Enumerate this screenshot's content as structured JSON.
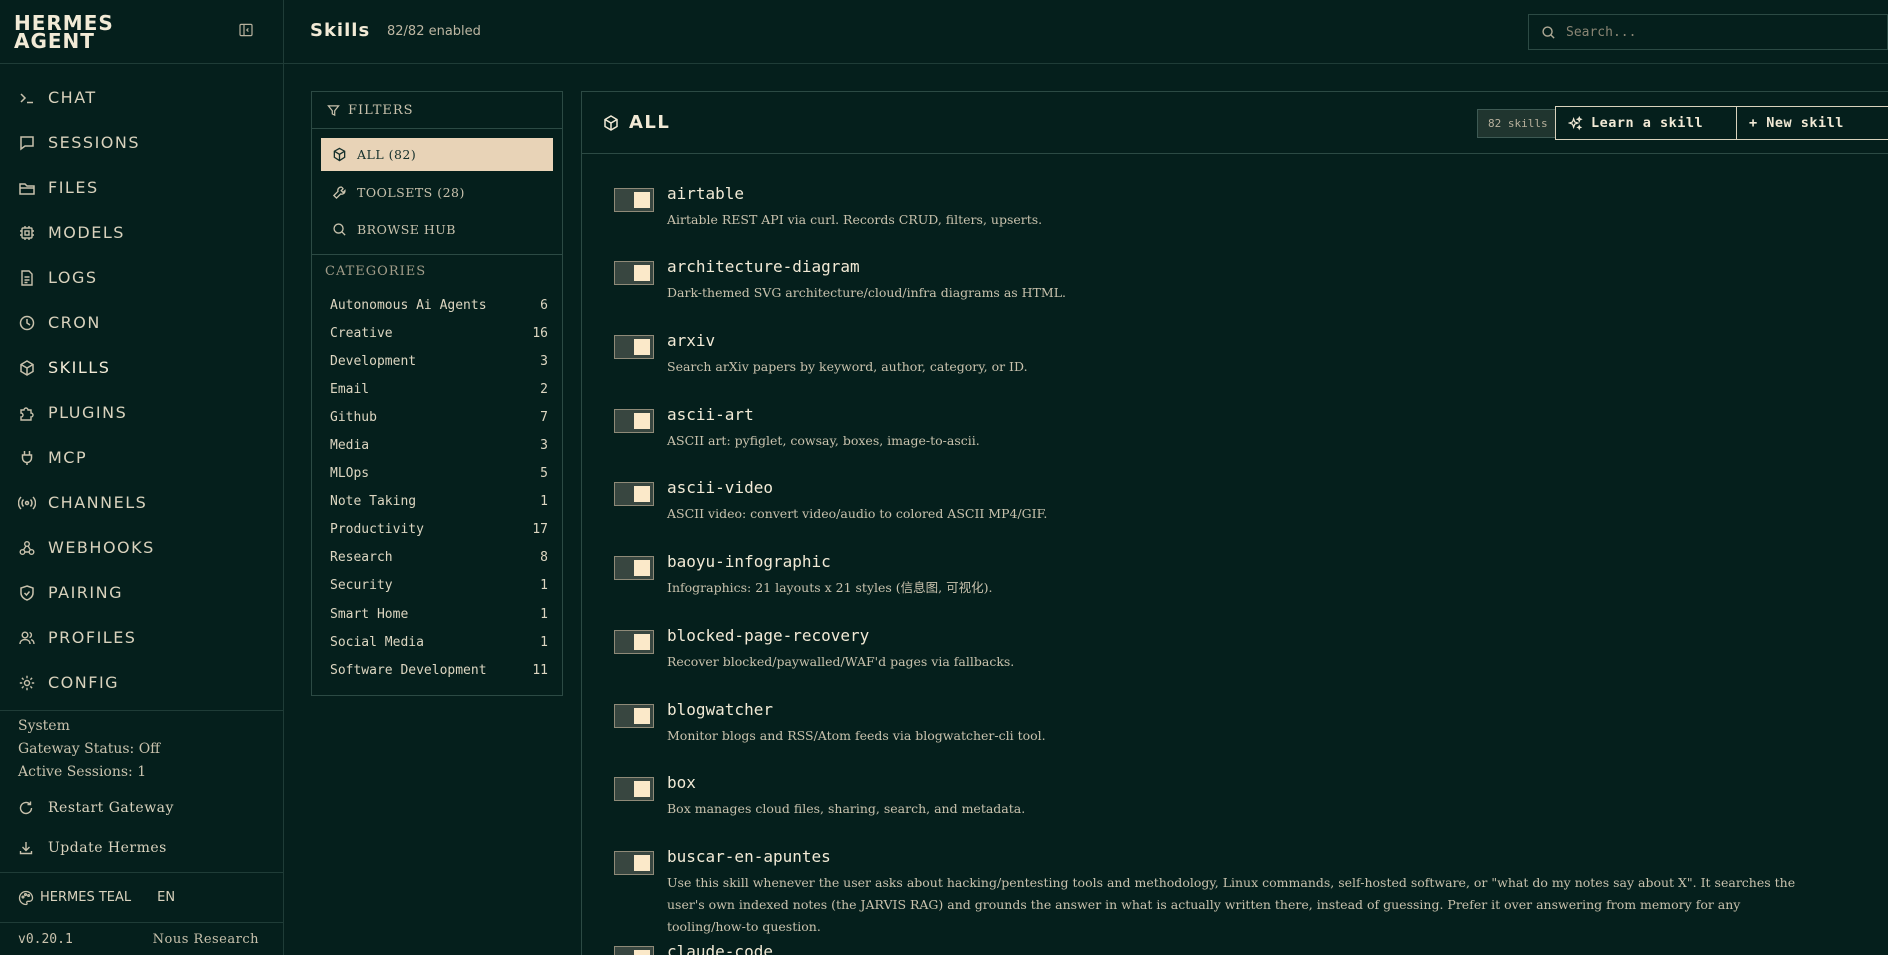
{
  "brand": {
    "title": "HERMES AGENT"
  },
  "nav": [
    {
      "label": "CHAT",
      "icon": "terminal-icon"
    },
    {
      "label": "SESSIONS",
      "icon": "message-icon"
    },
    {
      "label": "FILES",
      "icon": "folder-icon"
    },
    {
      "label": "MODELS",
      "icon": "cpu-icon"
    },
    {
      "label": "LOGS",
      "icon": "file-text-icon"
    },
    {
      "label": "CRON",
      "icon": "clock-icon"
    },
    {
      "label": "SKILLS",
      "icon": "package-icon"
    },
    {
      "label": "PLUGINS",
      "icon": "puzzle-icon"
    },
    {
      "label": "MCP",
      "icon": "plug-icon"
    },
    {
      "label": "CHANNELS",
      "icon": "radio-icon"
    },
    {
      "label": "WEBHOOKS",
      "icon": "webhook-icon"
    },
    {
      "label": "PAIRING",
      "icon": "shield-icon"
    },
    {
      "label": "PROFILES",
      "icon": "users-icon"
    },
    {
      "label": "CONFIG",
      "icon": "gear-icon"
    }
  ],
  "system": {
    "heading": "System",
    "gateway_status": "Gateway Status: Off",
    "active_sessions": "Active Sessions: 1",
    "restart_label": "Restart Gateway",
    "update_label": "Update Hermes"
  },
  "theme": {
    "name": "HERMES TEAL",
    "lang": "EN"
  },
  "footer": {
    "version": "v0.20.1",
    "org": "Nous Research"
  },
  "header": {
    "title": "Skills",
    "subtitle": "82/82 enabled",
    "search_placeholder": "Search..."
  },
  "filters": {
    "heading": "FILTERS",
    "options": [
      {
        "label": "ALL (82)",
        "icon": "package-icon"
      },
      {
        "label": "TOOLSETS (28)",
        "icon": "wrench-icon"
      },
      {
        "label": "BROWSE HUB",
        "icon": "search-icon"
      }
    ],
    "categories_heading": "CATEGORIES",
    "categories": [
      {
        "name": "Autonomous Ai Agents",
        "count": "6"
      },
      {
        "name": "Creative",
        "count": "16"
      },
      {
        "name": "Development",
        "count": "3"
      },
      {
        "name": "Email",
        "count": "2"
      },
      {
        "name": "Github",
        "count": "7"
      },
      {
        "name": "Media",
        "count": "3"
      },
      {
        "name": "MLOps",
        "count": "5"
      },
      {
        "name": "Note Taking",
        "count": "1"
      },
      {
        "name": "Productivity",
        "count": "17"
      },
      {
        "name": "Research",
        "count": "8"
      },
      {
        "name": "Security",
        "count": "1"
      },
      {
        "name": "Smart Home",
        "count": "1"
      },
      {
        "name": "Social Media",
        "count": "1"
      },
      {
        "name": "Software Development",
        "count": "11"
      }
    ]
  },
  "main": {
    "title": "ALL",
    "count_badge": "82 skills",
    "learn_label": "Learn a skill",
    "new_label": "+ New skill",
    "skills": [
      {
        "name": "airtable",
        "desc": "Airtable REST API via curl. Records CRUD, filters, upserts.",
        "enabled": true
      },
      {
        "name": "architecture-diagram",
        "desc": "Dark-themed SVG architecture/cloud/infra diagrams as HTML.",
        "enabled": true
      },
      {
        "name": "arxiv",
        "desc": "Search arXiv papers by keyword, author, category, or ID.",
        "enabled": true
      },
      {
        "name": "ascii-art",
        "desc": "ASCII art: pyfiglet, cowsay, boxes, image-to-ascii.",
        "enabled": true
      },
      {
        "name": "ascii-video",
        "desc": "ASCII video: convert video/audio to colored ASCII MP4/GIF.",
        "enabled": true
      },
      {
        "name": "baoyu-infographic",
        "desc": "Infographics: 21 layouts x 21 styles (信息图, 可视化).",
        "enabled": true
      },
      {
        "name": "blocked-page-recovery",
        "desc": "Recover blocked/paywalled/WAF'd pages via fallbacks.",
        "enabled": true
      },
      {
        "name": "blogwatcher",
        "desc": "Monitor blogs and RSS/Atom feeds via blogwatcher-cli tool.",
        "enabled": true
      },
      {
        "name": "box",
        "desc": "Box manages cloud files, sharing, search, and metadata.",
        "enabled": true
      },
      {
        "name": "buscar-en-apuntes",
        "desc": "Use this skill whenever the user asks about hacking/pentesting tools and methodology, Linux commands, self-hosted software, or \"what do my notes say about X\". It searches the user's own indexed notes (the JARVIS RAG) and grounds the answer in what is actually written there, instead of guessing. Prefer it over answering from memory for any tooling/how-to question.",
        "enabled": true
      },
      {
        "name": "claude-code",
        "desc": "",
        "enabled": true
      }
    ]
  }
}
